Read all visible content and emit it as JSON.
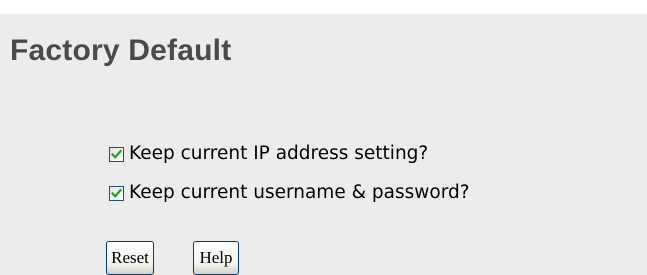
{
  "page": {
    "title": "Factory Default"
  },
  "options": [
    {
      "label": "Keep current IP address setting?",
      "checked": true
    },
    {
      "label": "Keep current username & password?",
      "checked": true
    }
  ],
  "buttons": {
    "reset_label": "Reset",
    "help_label": "Help"
  },
  "colors": {
    "panel_background": "#ececec",
    "title_text": "#4a4a4a",
    "checkmark": "#21a121",
    "control_border": "#1c5180"
  }
}
